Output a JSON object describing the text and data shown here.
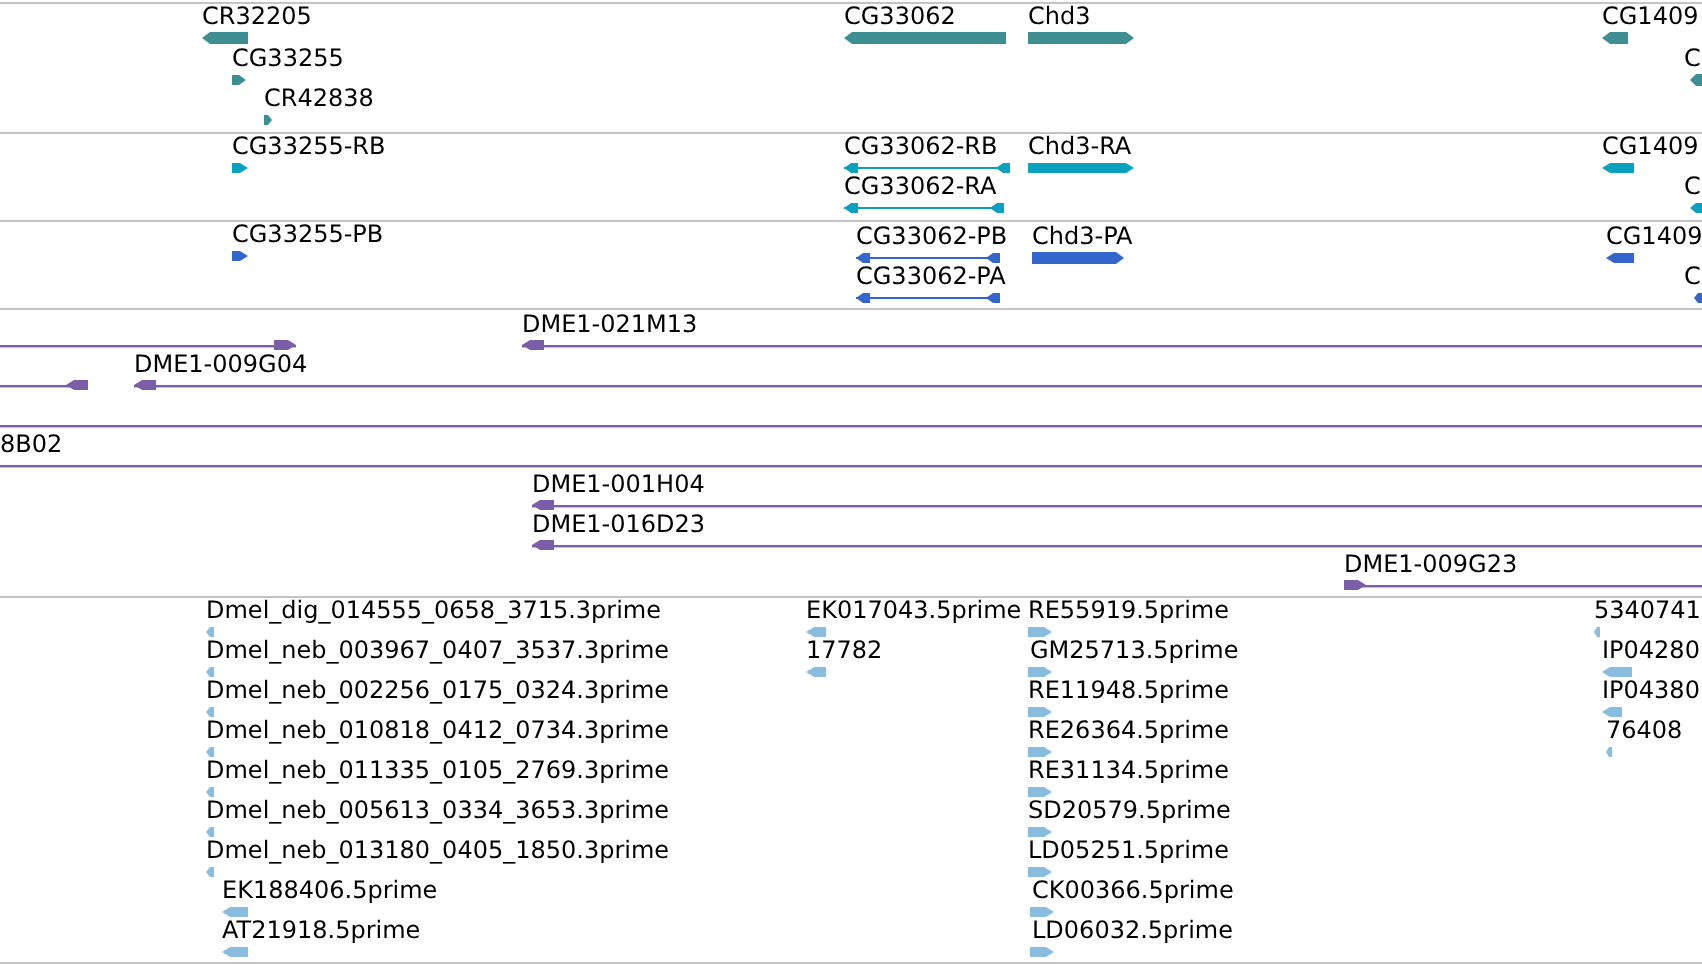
{
  "tracks": [
    {
      "kind": "gene",
      "color": "#3d8f92",
      "features": [
        {
          "label": "CR32205",
          "kind": "bar",
          "reverse": true
        },
        {
          "label": "CG33255",
          "kind": "bar",
          "reverse": false
        },
        {
          "label": "CR42838",
          "kind": "bar",
          "reverse": false
        },
        {
          "label": "CG33062",
          "kind": "bar",
          "reverse": true
        },
        {
          "label": "Chd3",
          "kind": "bar",
          "reverse": false
        },
        {
          "label": "CG1409",
          "kind": "bar",
          "reverse": true
        },
        {
          "label": "C",
          "kind": "bar",
          "reverse": true
        }
      ]
    },
    {
      "kind": "transcript",
      "color": "#0aa0c0",
      "features": [
        {
          "label": "CG33255-RB",
          "kind": "bar",
          "reverse": false
        },
        {
          "label": "CG33062-RB",
          "kind": "spliced",
          "reverse": true
        },
        {
          "label": "CG33062-RA",
          "kind": "spliced",
          "reverse": true
        },
        {
          "label": "Chd3-RA",
          "kind": "bar",
          "reverse": false
        },
        {
          "label": "CG1409",
          "kind": "bar",
          "reverse": true
        },
        {
          "label": "C",
          "kind": "bar",
          "reverse": true
        }
      ]
    },
    {
      "kind": "protein",
      "color": "#3366cc",
      "features": [
        {
          "label": "CG33255-PB",
          "kind": "bar",
          "reverse": false
        },
        {
          "label": "CG33062-PB",
          "kind": "spliced",
          "reverse": true
        },
        {
          "label": "CG33062-PA",
          "kind": "spliced",
          "reverse": true
        },
        {
          "label": "Chd3-PA",
          "kind": "bar",
          "reverse": false
        },
        {
          "label": "CG1409",
          "kind": "bar",
          "reverse": true
        },
        {
          "label": "C",
          "kind": "bar",
          "reverse": true
        }
      ]
    },
    {
      "kind": "clone",
      "color": "#7b5ea7",
      "features": [
        {
          "kind": "clone",
          "reverse": false
        },
        {
          "label": "DME1-021M13",
          "kind": "clone",
          "reverse": true
        },
        {
          "kind": "clone",
          "reverse": true
        },
        {
          "label": "DME1-009G04",
          "kind": "clone",
          "reverse": true
        },
        {
          "kind": "clone"
        },
        {
          "label": "8B02",
          "kind": "clone"
        },
        {
          "label": "DME1-001H04",
          "kind": "clone",
          "reverse": true
        },
        {
          "label": "DME1-016D23",
          "kind": "clone",
          "reverse": true
        },
        {
          "label": "DME1-009G23",
          "kind": "clone",
          "reverse": false
        }
      ]
    },
    {
      "kind": "est",
      "color": "#88bde0",
      "features": [
        {
          "label": "Dmel_dig_014555_0658_3715.3prime",
          "kind": "bar",
          "reverse": true
        },
        {
          "label": "Dmel_neb_003967_0407_3537.3prime",
          "kind": "bar",
          "reverse": true
        },
        {
          "label": "Dmel_neb_002256_0175_0324.3prime",
          "kind": "bar",
          "reverse": true
        },
        {
          "label": "Dmel_neb_010818_0412_0734.3prime",
          "kind": "bar",
          "reverse": true
        },
        {
          "label": "Dmel_neb_011335_0105_2769.3prime",
          "kind": "bar",
          "reverse": true
        },
        {
          "label": "Dmel_neb_005613_0334_3653.3prime",
          "kind": "bar",
          "reverse": true
        },
        {
          "label": "Dmel_neb_013180_0405_1850.3prime",
          "kind": "bar",
          "reverse": true
        },
        {
          "label": "EK188406.5prime",
          "kind": "bar",
          "reverse": true
        },
        {
          "label": "AT21918.5prime",
          "kind": "bar",
          "reverse": true
        },
        {
          "label": "EK017043.5prime",
          "kind": "bar",
          "reverse": true
        },
        {
          "label": "17782",
          "kind": "bar",
          "reverse": true
        },
        {
          "label": "RE55919.5prime",
          "kind": "bar",
          "reverse": false
        },
        {
          "label": "GM25713.5prime",
          "kind": "bar",
          "reverse": false
        },
        {
          "label": "RE11948.5prime",
          "kind": "bar",
          "reverse": false
        },
        {
          "label": "RE26364.5prime",
          "kind": "bar",
          "reverse": false
        },
        {
          "label": "RE31134.5prime",
          "kind": "bar",
          "reverse": false
        },
        {
          "label": "SD20579.5prime",
          "kind": "bar",
          "reverse": false
        },
        {
          "label": "LD05251.5prime",
          "kind": "bar",
          "reverse": false
        },
        {
          "label": "CK00366.5prime",
          "kind": "bar",
          "reverse": false
        },
        {
          "label": "LD06032.5prime",
          "kind": "bar",
          "reverse": false
        },
        {
          "label": "5340741",
          "kind": "bar",
          "reverse": true
        },
        {
          "label": "IP04280",
          "kind": "bar",
          "reverse": true
        },
        {
          "label": "IP04380",
          "kind": "bar",
          "reverse": true
        },
        {
          "label": "76408",
          "kind": "bar",
          "reverse": true
        }
      ]
    }
  ]
}
